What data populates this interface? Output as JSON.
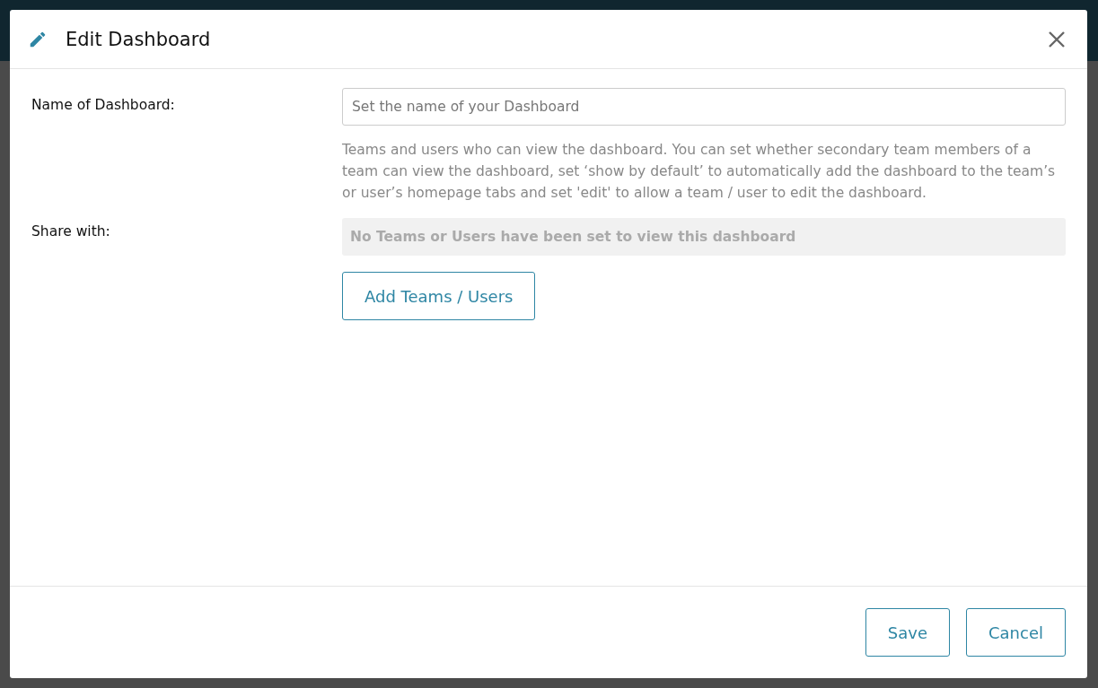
{
  "dialog": {
    "title": "Edit Dashboard",
    "fields": [
      {
        "label": "Name of Dashboard:",
        "placeholder": "Set the name of your Dashboard"
      }
    ],
    "share": {
      "label": "Share with:",
      "help": "Teams and users who can view the dashboard. You can set whether secondary team members of a team can view the dashboard, set ‘show by default’ to automatically add the dashboard to the team’s or user’s homepage tabs and set 'edit' to allow a team / user to edit the dashboard.",
      "empty_message": "No Teams or Users have been set to view this dashboard",
      "add_button": "Add Teams / Users"
    },
    "buttons": [
      "Save",
      "Cancel"
    ]
  }
}
